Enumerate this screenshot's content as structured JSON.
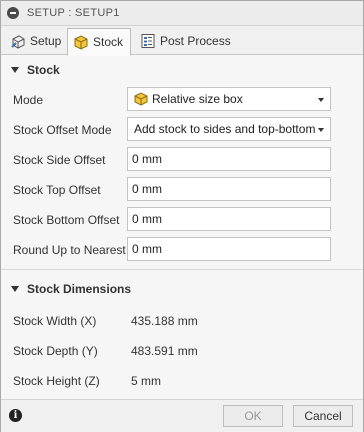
{
  "window": {
    "title": "SETUP : SETUP1"
  },
  "tabs": [
    {
      "label": "Setup"
    },
    {
      "label": "Stock"
    },
    {
      "label": "Post Process"
    }
  ],
  "stock": {
    "header": "Stock",
    "mode": {
      "label": "Mode",
      "value": "Relative size box"
    },
    "offset_mode": {
      "label": "Stock Offset Mode",
      "value": "Add stock to sides and top-bottom"
    },
    "side_offset": {
      "label": "Stock Side Offset",
      "value": "0 mm"
    },
    "top_offset": {
      "label": "Stock Top Offset",
      "value": "0 mm"
    },
    "bottom_offset": {
      "label": "Stock Bottom Offset",
      "value": "0 mm"
    },
    "round_up": {
      "label": "Round Up to Nearest",
      "value": "0 mm"
    }
  },
  "dimensions": {
    "header": "Stock Dimensions",
    "width": {
      "label": "Stock Width (X)",
      "value": "435.188 mm"
    },
    "depth": {
      "label": "Stock Depth (Y)",
      "value": "483.591 mm"
    },
    "height": {
      "label": "Stock Height (Z)",
      "value": "5 mm"
    }
  },
  "footer": {
    "ok_label": "OK",
    "cancel_label": "Cancel"
  },
  "colors": {
    "accent_yellow": "#f2c53d",
    "icon_blue": "#3c6fb4"
  }
}
